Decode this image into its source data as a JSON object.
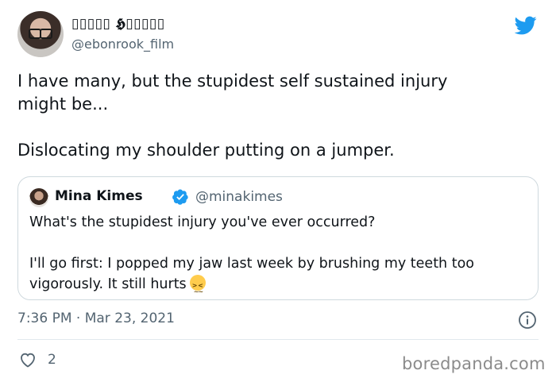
{
  "tweet": {
    "display_name": "▯▯▯▯▯ 𝕳▯▯▯▯▯",
    "handle": "@ebonrook_film",
    "text_paragraphs": [
      "I have many, but the stupidest self sustained injury\nmight be...",
      "Dislocating my shoulder putting on a jumper."
    ],
    "timestamp": "7:36 PM · Mar 23, 2021",
    "like_count": "2"
  },
  "quoted_tweet": {
    "display_name": "Mina Kimes",
    "handle": "@minakimes",
    "verified": true,
    "text_paragraphs": [
      "What's the stupidest injury you've ever occurred?",
      "I'll go first: I popped my jaw last week by brushing my teeth too\nvigorously. It still hurts"
    ],
    "emoji": "confounded-face"
  },
  "watermark": "boredpanda.com",
  "colors": {
    "twitter_blue": "#1d9bf0",
    "text_primary": "#0f1419",
    "text_secondary": "#536471",
    "border": "#cfd9de"
  },
  "icons": [
    "twitter-bird-icon",
    "verified-badge-icon",
    "info-icon",
    "heart-icon"
  ]
}
